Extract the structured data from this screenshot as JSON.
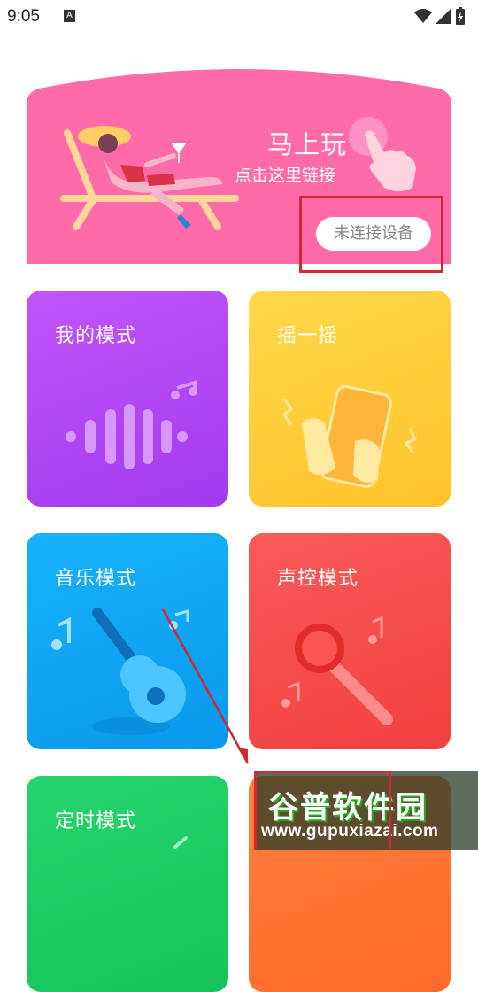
{
  "status_bar": {
    "time": "9:05",
    "notification_icon": "A"
  },
  "hero": {
    "title": "马上玩",
    "subtitle": "点击这里链接",
    "connect_button": "未连接设备",
    "color": "#ff6aa9"
  },
  "cards": [
    {
      "label": "我的模式",
      "color": "#b34df5",
      "icon": "sound-wave-icon"
    },
    {
      "label": "摇一摇",
      "color": "#ffcc33",
      "icon": "shake-phone-icon"
    },
    {
      "label": "音乐模式",
      "color": "#1ea7f5",
      "icon": "guitar-icon"
    },
    {
      "label": "声控模式",
      "color": "#f6514f",
      "icon": "microphone-icon"
    },
    {
      "label": "定时模式",
      "color": "#22cc66",
      "icon": "timer-icon"
    }
  ],
  "watermark": {
    "title": "谷普软件园",
    "url": "www.gupuxiazai.com"
  }
}
